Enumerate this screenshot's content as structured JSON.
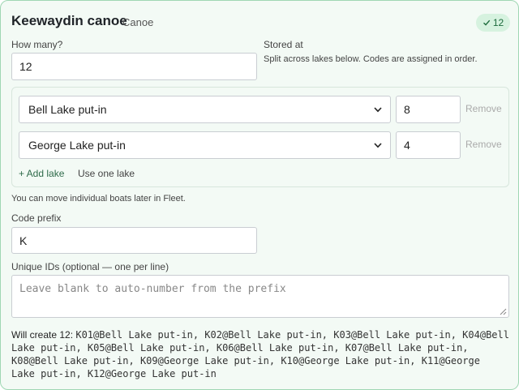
{
  "header": {
    "title": "Keewaydin canoe",
    "subtitle": "Canoe",
    "badge_icon": "check-icon",
    "badge_count": "12"
  },
  "quantity": {
    "label": "How many?",
    "value": "12"
  },
  "stored_at": {
    "label": "Stored at",
    "hint": "Split across lakes below. Codes are assigned in order."
  },
  "split": {
    "rows": [
      {
        "lake": "Bell Lake put-in",
        "count": "8",
        "remove_label": "Remove"
      },
      {
        "lake": "George Lake put-in",
        "count": "4",
        "remove_label": "Remove"
      }
    ],
    "add_lake_label": "+ Add lake",
    "use_one_lake_label": "Use one lake"
  },
  "fleet_note": "You can move individual boats later in Fleet.",
  "code_prefix": {
    "label": "Code prefix",
    "value": "K"
  },
  "unique_ids": {
    "label": "Unique IDs (optional — one per line)",
    "placeholder": "Leave blank to auto-number from the prefix"
  },
  "summary": {
    "prefix": "Will create 12: ",
    "codes": "K01@Bell Lake put-in, K02@Bell Lake put-in, K03@Bell Lake put-in, K04@Bell Lake put-in, K05@Bell Lake put-in, K06@Bell Lake put-in, K07@Bell Lake put-in, K08@Bell Lake put-in, K09@George Lake put-in, K10@George Lake put-in, K11@George Lake put-in, K12@George Lake put-in"
  },
  "colors": {
    "card_bg": "#f3faf5",
    "card_border": "#9fd7b3",
    "badge_bg": "#d6f2df",
    "badge_text": "#1d6b3c",
    "link": "#2f6b4a"
  }
}
